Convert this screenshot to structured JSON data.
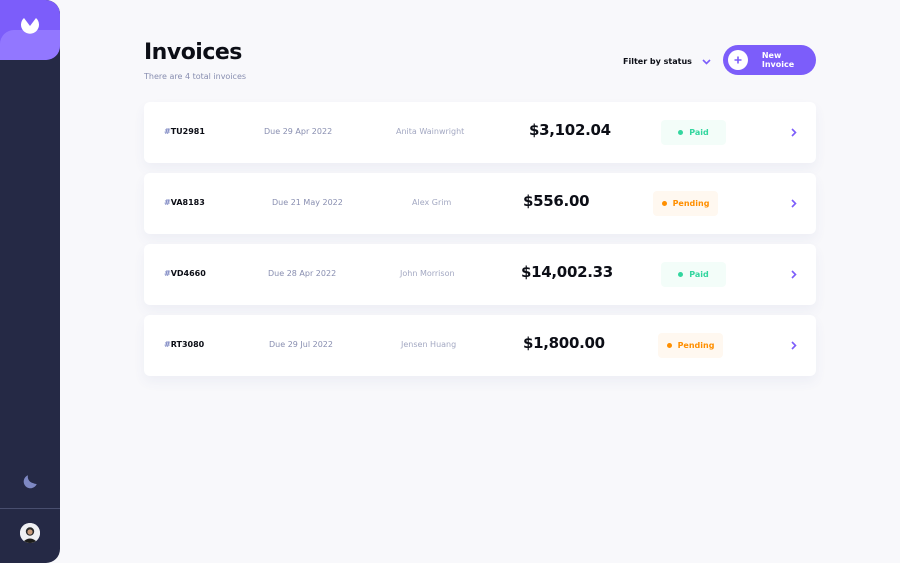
{
  "header": {
    "title": "Invoices",
    "subtitle": "There are 4 total invoices",
    "filter_label": "Filter by status",
    "new_invoice_label": "New Invoice"
  },
  "colors": {
    "accent": "#7c5dfa",
    "sidebar": "#252945",
    "paid": "#33d69f",
    "pending": "#ff8f00"
  },
  "icons": {
    "logo": "logo-icon",
    "theme_toggle": "moon-icon",
    "filter": "chevron-down-icon",
    "new_invoice": "plus-icon",
    "row_action": "chevron-right-icon"
  },
  "invoices": [
    {
      "hash": "#",
      "id": "TU2981",
      "due": "Due 29 Apr 2022",
      "client": "Anita Wainwright",
      "amount": "$3,102.04",
      "status": "Paid"
    },
    {
      "hash": "#",
      "id": "VA8183",
      "due": "Due 21 May 2022",
      "client": "Alex Grim",
      "amount": "$556.00",
      "status": "Pending"
    },
    {
      "hash": "#",
      "id": "VD4660",
      "due": "Due 28 Apr 2022",
      "client": "John Morrison",
      "amount": "$14,002.33",
      "status": "Paid"
    },
    {
      "hash": "#",
      "id": "RT3080",
      "due": "Due 29 Jul 2022",
      "client": "Jensen Huang",
      "amount": "$1,800.00",
      "status": "Pending"
    }
  ]
}
